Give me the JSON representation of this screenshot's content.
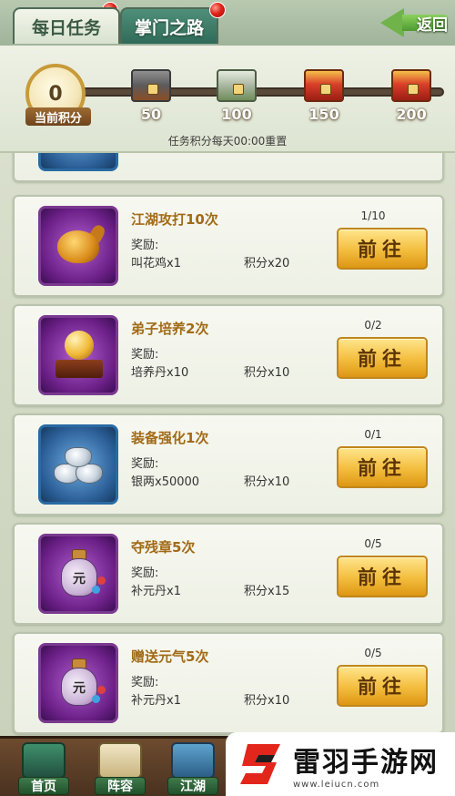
{
  "tabs": [
    {
      "label": "每日任务",
      "active": true
    },
    {
      "label": "掌门之路",
      "active": false
    }
  ],
  "back_button": {
    "label": "返回"
  },
  "score": {
    "current": "0",
    "label": "当前积分",
    "milestones": [
      "50",
      "100",
      "150",
      "200"
    ],
    "reset_note": "任务积分每天00:00重置"
  },
  "tasks": [
    {
      "title": "江湖攻打10次",
      "progress": "1/10",
      "reward_label": "奖励:",
      "reward_item": "叫花鸡x1",
      "reward_points": "积分x20",
      "button": "前往",
      "icon": "roast-chicken-icon"
    },
    {
      "title": "弟子培养2次",
      "progress": "0/2",
      "reward_label": "奖励:",
      "reward_item": "培养丹x10",
      "reward_points": "积分x10",
      "button": "前往",
      "icon": "golden-orb-icon"
    },
    {
      "title": "装备强化1次",
      "progress": "0/1",
      "reward_label": "奖励:",
      "reward_item": "银两x50000",
      "reward_points": "积分x10",
      "button": "前往",
      "icon": "silver-ingots-icon"
    },
    {
      "title": "夺残章5次",
      "progress": "0/5",
      "reward_label": "奖励:",
      "reward_item": "补元丹x1",
      "reward_points": "积分x15",
      "button": "前往",
      "icon": "elixir-bottle-icon"
    },
    {
      "title": "赠送元气5次",
      "progress": "0/5",
      "reward_label": "奖励:",
      "reward_item": "补元丹x1",
      "reward_points": "积分x10",
      "button": "前往",
      "icon": "elixir-bottle-icon"
    }
  ],
  "bottom_nav": [
    {
      "label": "首页",
      "icon": "home-building-icon"
    },
    {
      "label": "阵容",
      "icon": "formation-scroll-icon"
    },
    {
      "label": "江湖",
      "icon": "jianghu-book-icon"
    }
  ],
  "watermark": {
    "title": "雷羽手游网",
    "url": "www.leiucn.com"
  },
  "colors": {
    "accent_gold": "#f3bd3d",
    "title_orange": "#a26a16",
    "tab_green": "#2f6b58",
    "notification_red": "#e0231a"
  }
}
